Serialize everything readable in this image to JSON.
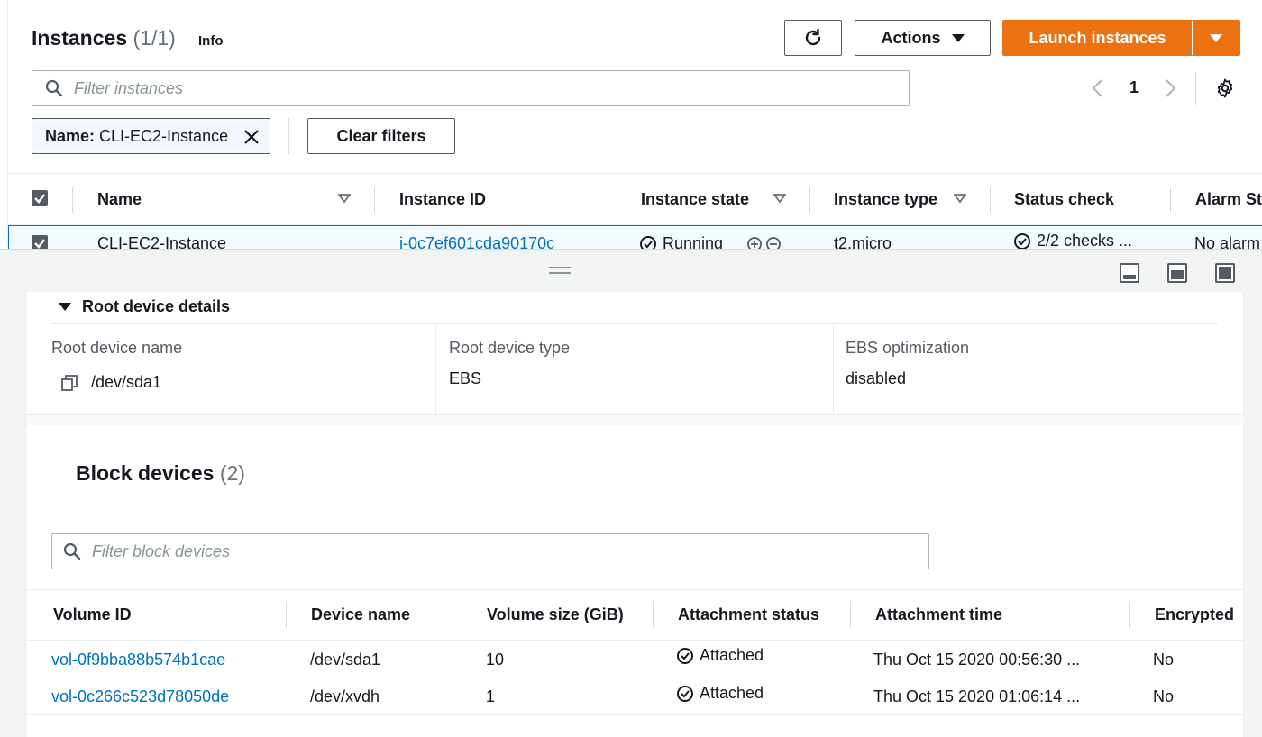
{
  "header": {
    "title": "Instances",
    "count": "(1/1)",
    "info_label": "Info",
    "actions_label": "Actions",
    "launch_label": "Launch instances"
  },
  "search": {
    "placeholder": "Filter instances"
  },
  "pagination": {
    "current_page": "1"
  },
  "filter_token": {
    "key": "Name:",
    "value": "CLI-EC2-Instance"
  },
  "clear_filters_label": "Clear filters",
  "instances_table": {
    "columns": [
      "Name",
      "Instance ID",
      "Instance state",
      "Instance type",
      "Status check",
      "Alarm St"
    ],
    "rows": [
      {
        "name": "CLI-EC2-Instance",
        "instance_id": "i-0c7ef601cda90170c",
        "state": "Running",
        "type": "t2.micro",
        "status_check": "2/2 checks ...",
        "alarm": "No alarm"
      }
    ]
  },
  "root_device": {
    "section_title": "Root device details",
    "name_label": "Root device name",
    "name_value": "/dev/sda1",
    "type_label": "Root device type",
    "type_value": "EBS",
    "ebs_label": "EBS optimization",
    "ebs_value": "disabled"
  },
  "block_devices": {
    "title": "Block devices",
    "count": "(2)",
    "search_placeholder": "Filter block devices",
    "columns": [
      "Volume ID",
      "Device name",
      "Volume size (GiB)",
      "Attachment status",
      "Attachment time",
      "Encrypted"
    ],
    "rows": [
      {
        "volume_id": "vol-0f9bba88b574b1cae",
        "device": "/dev/sda1",
        "size": "10",
        "status": "Attached",
        "time": "Thu Oct 15 2020 00:56:30 ...",
        "encrypted": "No"
      },
      {
        "volume_id": "vol-0c266c523d78050de",
        "device": "/dev/xvdh",
        "size": "1",
        "status": "Attached",
        "time": "Thu Oct 15 2020 01:06:14 ...",
        "encrypted": "No"
      }
    ]
  },
  "colors": {
    "primary_orange": "#ec7211",
    "link_blue": "#0073bb",
    "text_dark": "#16191f",
    "muted_gray": "#687078"
  }
}
